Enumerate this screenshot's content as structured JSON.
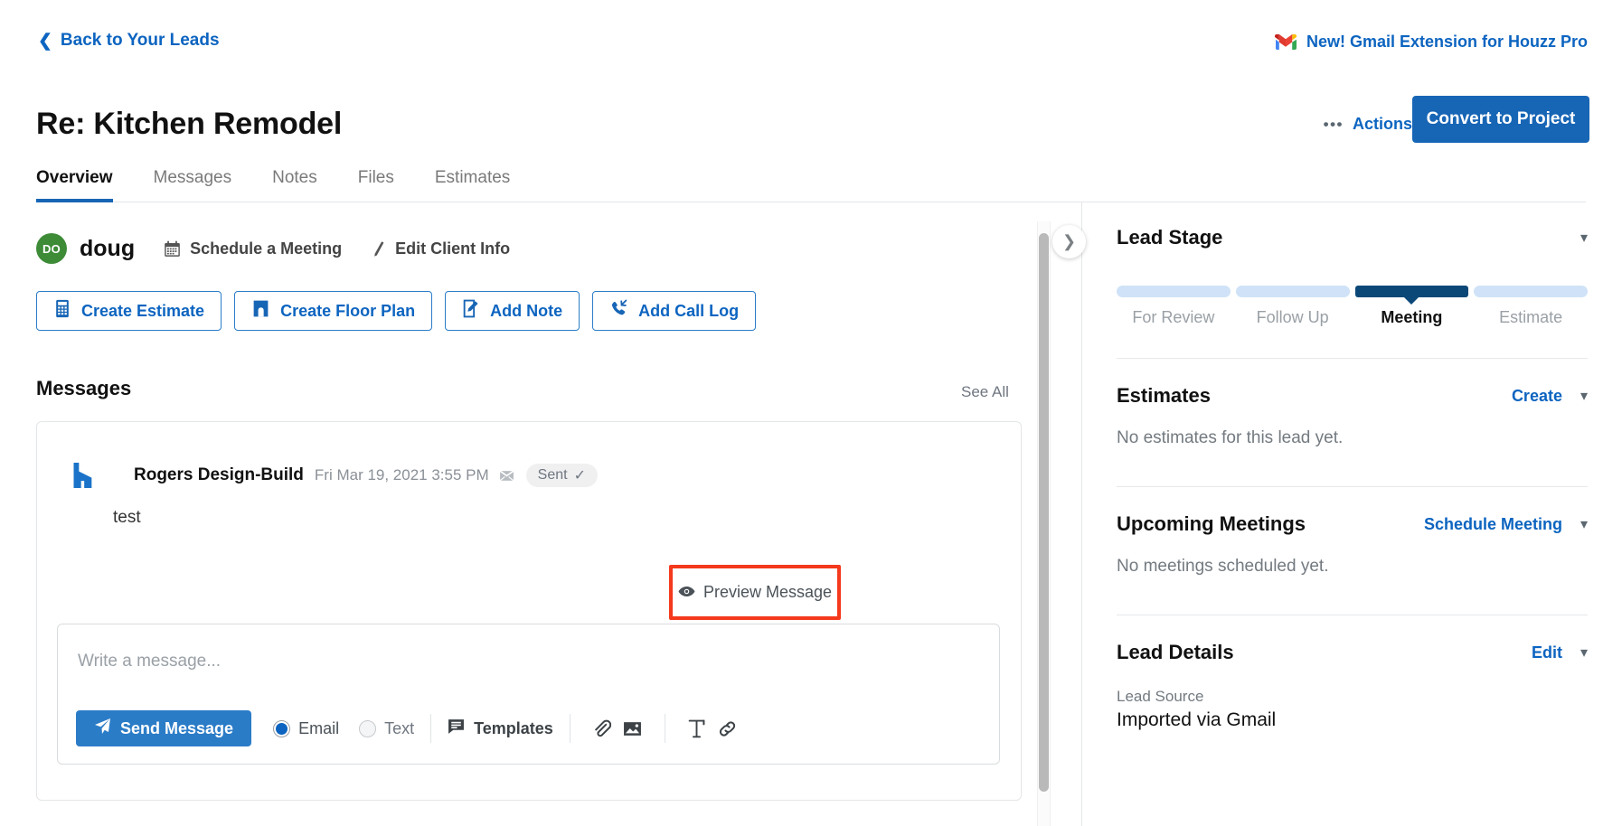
{
  "topbar": {
    "back_link": "Back to Your Leads",
    "gmail_promo": "New! Gmail Extension for Houzz Pro"
  },
  "header": {
    "title": "Re: Kitchen Remodel",
    "actions_label": "Actions",
    "actions_dots": "•••",
    "convert_label": "Convert to Project"
  },
  "tabs": [
    {
      "label": "Overview",
      "active": true
    },
    {
      "label": "Messages",
      "active": false
    },
    {
      "label": "Notes",
      "active": false
    },
    {
      "label": "Files",
      "active": false
    },
    {
      "label": "Estimates",
      "active": false
    }
  ],
  "contact": {
    "avatar_initials": "DO",
    "avatar_color": "#3d8b37",
    "name": "doug",
    "schedule_meeting": "Schedule a Meeting",
    "edit_client_info": "Edit Client Info"
  },
  "quick_actions": [
    {
      "label": "Create Estimate",
      "icon": "calculator-icon"
    },
    {
      "label": "Create Floor Plan",
      "icon": "floorplan-icon"
    },
    {
      "label": "Add Note",
      "icon": "note-edit-icon"
    },
    {
      "label": "Add Call Log",
      "icon": "phone-missed-icon"
    }
  ],
  "messages": {
    "heading": "Messages",
    "see_all": "See All",
    "item": {
      "sender": "Rogers Design-Build",
      "timestamp": "Fri Mar 19, 2021 3:55 PM",
      "status": "Sent",
      "status_check": "✓",
      "body": "test"
    },
    "preview_label": "Preview Message",
    "preview_highlight_color": "#f4391c"
  },
  "composer": {
    "placeholder": "Write a message...",
    "send_label": "Send Message",
    "channels": [
      {
        "label": "Email",
        "selected": true
      },
      {
        "label": "Text",
        "selected": false
      }
    ],
    "templates_label": "Templates",
    "tools": [
      "attachment-icon",
      "image-icon",
      "text-format-icon",
      "link-icon"
    ]
  },
  "sidebar": {
    "lead_stage": {
      "title": "Lead Stage",
      "stages": [
        {
          "label": "For Review",
          "active": false
        },
        {
          "label": "Follow Up",
          "active": false
        },
        {
          "label": "Meeting",
          "active": true
        },
        {
          "label": "Estimate",
          "active": false
        }
      ],
      "active_color": "#0b4878",
      "inactive_color": "#cfe2f7"
    },
    "estimates": {
      "title": "Estimates",
      "link": "Create",
      "empty": "No estimates for this lead yet."
    },
    "upcoming_meetings": {
      "title": "Upcoming Meetings",
      "link": "Schedule Meeting",
      "empty": "No meetings scheduled yet."
    },
    "lead_details": {
      "title": "Lead Details",
      "link": "Edit",
      "field_label": "Lead Source",
      "field_value": "Imported via Gmail"
    }
  }
}
